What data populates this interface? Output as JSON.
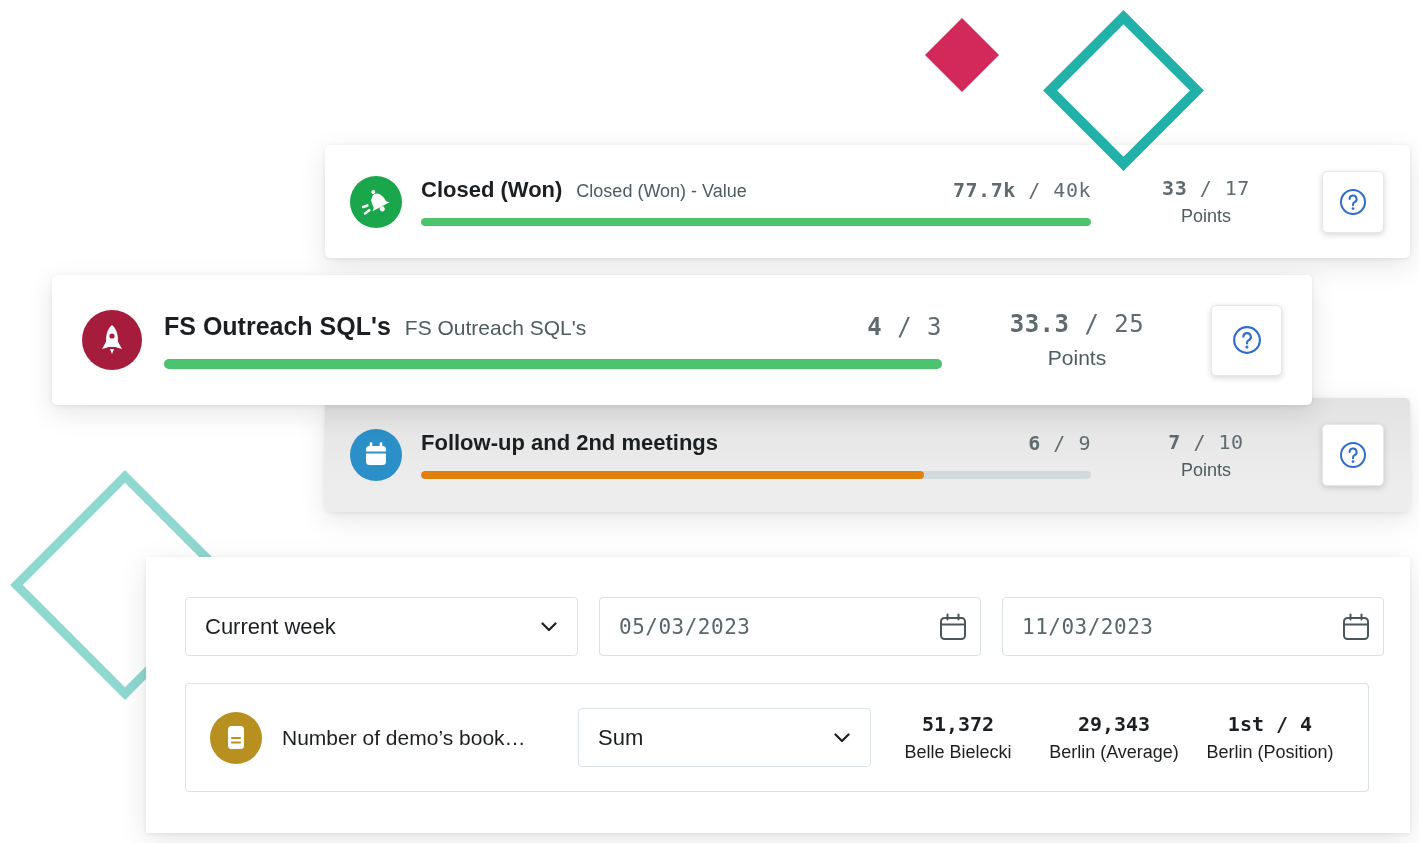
{
  "goals": [
    {
      "kind": "plain",
      "color": "#1aa64a",
      "title": "Closed (Won)",
      "subtitle": "Closed (Won) - Value",
      "reading": "**77.7k** / 40k",
      "level": 1,
      "points": "**33** / 17",
      "points_label": "Points"
    },
    {
      "kind": "featured",
      "color": "#a51c3c",
      "title": "FS Outreach SQL's",
      "subtitle": "FS Outreach SQL's",
      "reading": "**4** / 3",
      "level": 1,
      "points": "**33.3** / 25",
      "points_label": "Points"
    },
    {
      "kind": "dimmed",
      "color": "#2b8fc8",
      "title": "Follow-up and 2nd meetings",
      "reading": "**6** / 9",
      "level": 0.75,
      "points": "**7** / 10",
      "points_label": "Points"
    }
  ],
  "filters": {
    "period": "Current week",
    "start_date": "05/03/2023",
    "end_date": "11/03/2023"
  },
  "metric": {
    "color": "#b8901f",
    "name": "Number of demo’s book…",
    "aggregation": "Sum",
    "stats": [
      {
        "value": "51,372",
        "label": "Belle Bielecki"
      },
      {
        "value": "29,343",
        "label": "Berlin (Average)"
      },
      {
        "value": "**1st** / 4",
        "label": "Berlin (Position)"
      }
    ]
  }
}
